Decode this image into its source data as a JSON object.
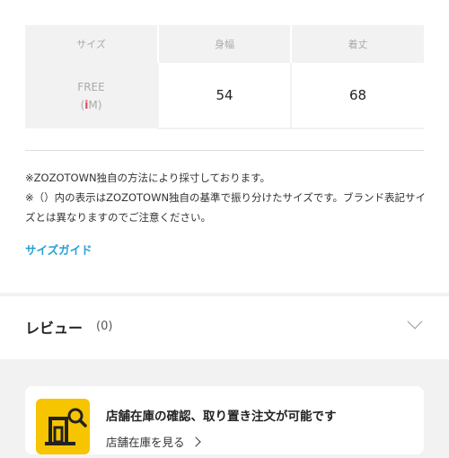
{
  "size_table": {
    "headers": [
      "サイズ",
      "身幅",
      "着丈"
    ],
    "row": {
      "size": "FREE",
      "gender_icon": "i",
      "size_code": "M",
      "values": [
        "54",
        "68"
      ]
    }
  },
  "notes": [
    "※ZOZOTOWN独自の方法により採寸しております。",
    "※（）内の表示はZOZOTOWN独自の基準で振り分けたサイズです。ブランド表記サイズとは異なりますのでご注意ください。"
  ],
  "size_guide_label": "サイズガイド",
  "review": {
    "title": "レビュー",
    "count": "(0)"
  },
  "store": {
    "title": "店舗在庫の確認、取り置き注文が可能です",
    "link_label": "店舗在庫を見る",
    "icon": "store-search-icon",
    "icon_bg": "#f7c400"
  },
  "colors": {
    "link": "#2a9fd6",
    "gender_icon": "#e0475a"
  }
}
